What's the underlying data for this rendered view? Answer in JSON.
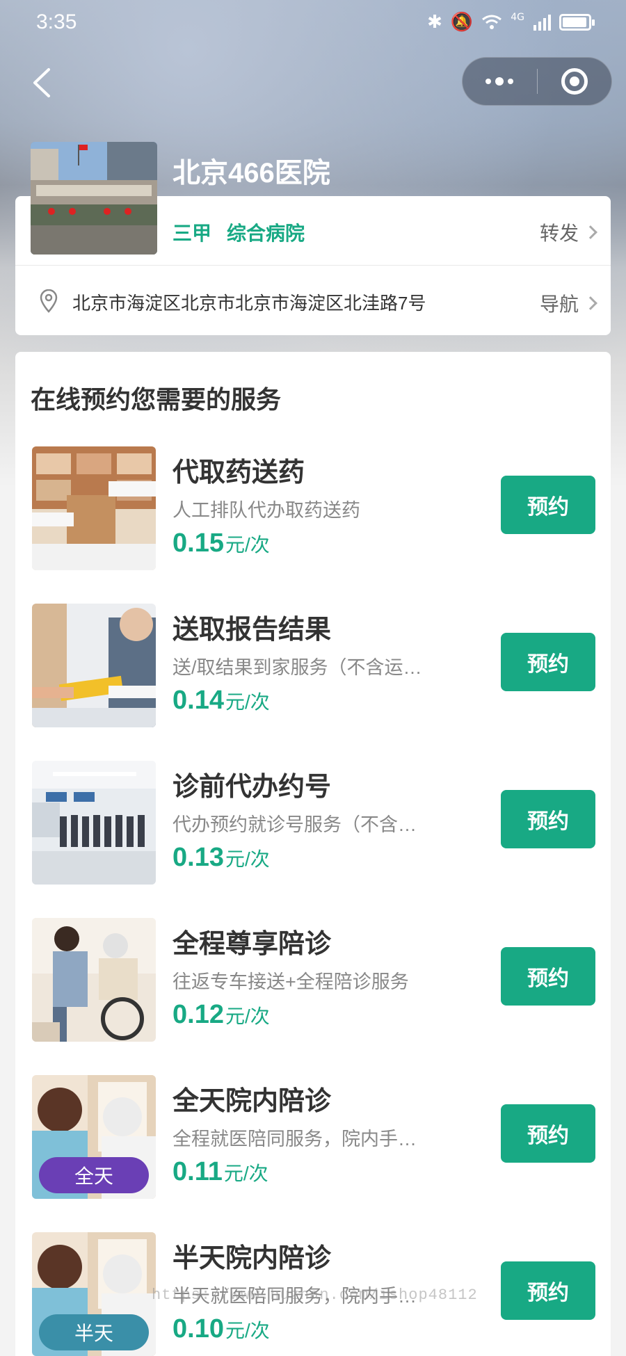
{
  "status_bar": {
    "time": "3:35",
    "network": "4G"
  },
  "hospital": {
    "name": "北京466医院",
    "tags": [
      "三甲",
      "综合病院"
    ],
    "forward_label": "转发",
    "address": "北京市海淀区北京市北京市海淀区北洼路7号",
    "nav_label": "导航"
  },
  "services_title": "在线预约您需要的服务",
  "services": [
    {
      "name": "代取药送药",
      "desc": "人工排队代办取药送药",
      "price": "0.15",
      "unit": "元/次",
      "button": "预约",
      "badge": ""
    },
    {
      "name": "送取报告结果",
      "desc": "送/取结果到家服务（不含运…",
      "price": "0.14",
      "unit": "元/次",
      "button": "预约",
      "badge": ""
    },
    {
      "name": "诊前代办约号",
      "desc": "代办预约就诊号服务（不含…",
      "price": "0.13",
      "unit": "元/次",
      "button": "预约",
      "badge": ""
    },
    {
      "name": "全程尊享陪诊",
      "desc": "往返专车接送+全程陪诊服务",
      "price": "0.12",
      "unit": "元/次",
      "button": "预约",
      "badge": ""
    },
    {
      "name": "全天院内陪诊",
      "desc": "全程就医陪同服务，院内手…",
      "price": "0.11",
      "unit": "元/次",
      "button": "预约",
      "badge": "全天"
    },
    {
      "name": "半天院内陪诊",
      "desc": "半天就医陪同服务，院内手…",
      "price": "0.10",
      "unit": "元/次",
      "button": "预约",
      "badge": "半天"
    }
  ],
  "watermark": "https://www.huzhan.com/ishop48112",
  "colors": {
    "accent": "#18a984",
    "badge_full_day": "#6a3fb5",
    "badge_half_day": "#3a8fa8"
  }
}
